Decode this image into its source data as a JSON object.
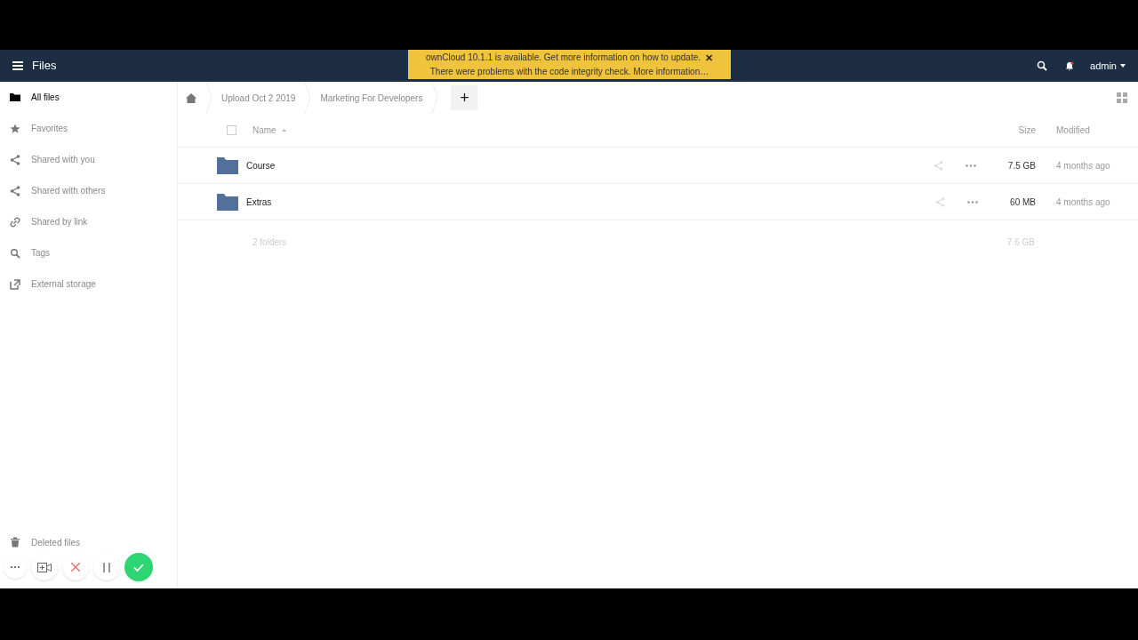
{
  "header": {
    "app_title": "Files",
    "user_menu": "admin"
  },
  "notification": {
    "lines": [
      "ownCloud 10.1.1 is available. Get more information on how to update.",
      "There were problems with the code integrity check. More information…"
    ],
    "close": "✕"
  },
  "sidebar": {
    "items": [
      {
        "label": "All files",
        "kind": "folder",
        "selected": true
      },
      {
        "label": "Favorites",
        "kind": "star",
        "selected": false
      },
      {
        "label": "Shared with you",
        "kind": "share",
        "selected": false
      },
      {
        "label": "Shared with others",
        "kind": "share",
        "selected": false
      },
      {
        "label": "Shared by link",
        "kind": "link",
        "selected": false
      },
      {
        "label": "Tags",
        "kind": "search",
        "selected": false
      },
      {
        "label": "External storage",
        "kind": "external",
        "selected": false
      }
    ],
    "bottom_items": [
      {
        "label": "Deleted files",
        "kind": "trash",
        "selected": false
      }
    ]
  },
  "breadcrumb": [
    "Upload Oct 2 2019",
    "Marketing For Developers"
  ],
  "new_button": "+",
  "table": {
    "select_all": {
      "checked": false
    },
    "columns": [
      "Name",
      "Size",
      "Modified"
    ],
    "rows": [
      {
        "name": "Course",
        "size": "7.5 GB",
        "modified": "4 months ago"
      },
      {
        "name": "Extras",
        "size": "60 MB",
        "modified": "4 months ago"
      }
    ],
    "summary": {
      "count": "2 folders",
      "size": "7.6 GB"
    }
  },
  "recorder_toolbar": {
    "buttons": [
      {
        "kind": "more"
      },
      {
        "kind": "camera"
      },
      {
        "kind": "cancel"
      },
      {
        "kind": "pause"
      },
      {
        "kind": "done"
      }
    ]
  }
}
